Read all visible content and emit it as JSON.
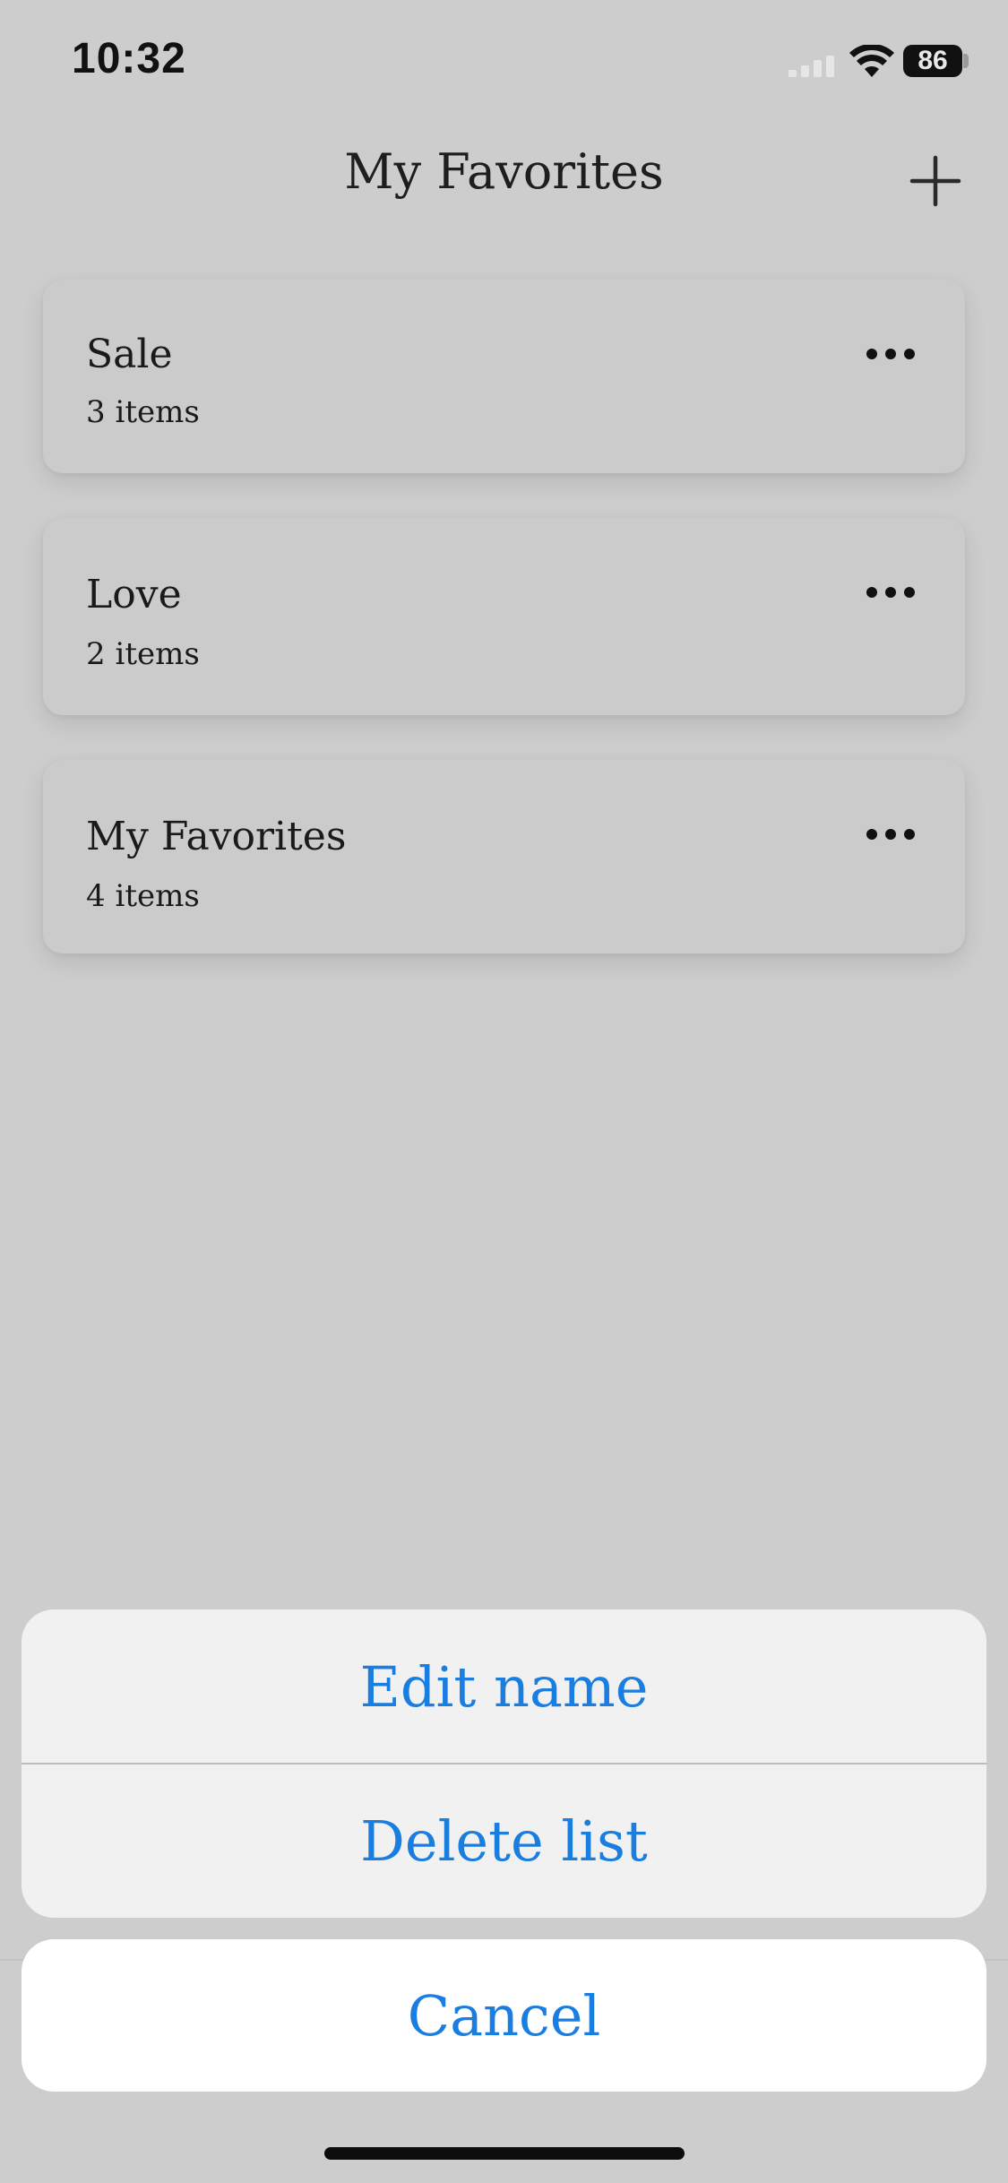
{
  "status_bar": {
    "time": "10:32",
    "battery": "86"
  },
  "header": {
    "title": "My Favorites"
  },
  "lists": [
    {
      "name": "Sale",
      "count": "3 items"
    },
    {
      "name": "Love",
      "count": "2 items"
    },
    {
      "name": "My Favorites",
      "count": "4 items"
    }
  ],
  "action_sheet": {
    "edit_label": "Edit name",
    "delete_label": "Delete list",
    "cancel_label": "Cancel"
  },
  "colors": {
    "accent": "#1a7de0",
    "background": "#cdcdcd",
    "sheet": "#f1f1f1"
  },
  "icons": {
    "add": "plus-icon",
    "more": "ellipsis-icon",
    "wifi": "wifi-icon",
    "signal": "cellular-signal-icon",
    "battery": "battery-icon"
  }
}
